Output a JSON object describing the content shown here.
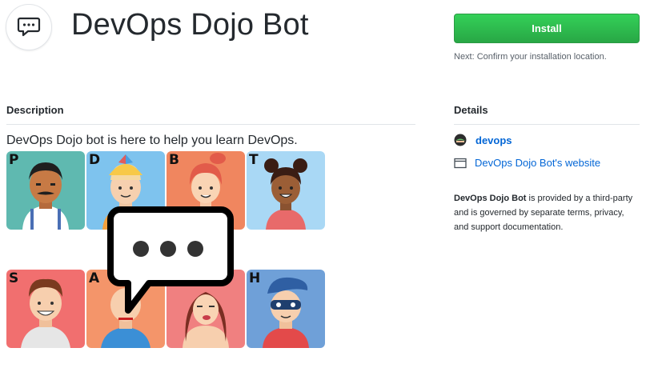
{
  "app": {
    "title": "DevOps Dojo Bot",
    "logo_icon": "chat-bubble-icon"
  },
  "install": {
    "button_label": "Install",
    "hint": "Next: Confirm your installation location."
  },
  "description": {
    "heading": "Description",
    "text": "DevOps Dojo bot is here to help you learn DevOps.",
    "tiles": [
      {
        "letter": "P",
        "bg": "#5fb9b0"
      },
      {
        "letter": "D",
        "bg": "#7ec3ee"
      },
      {
        "letter": "B",
        "bg": "#f0865f"
      },
      {
        "letter": "T",
        "bg": "#a9d8f5"
      },
      {
        "letter": "S",
        "bg": "#f16f6f"
      },
      {
        "letter": "A",
        "bg": "#f4956a"
      },
      {
        "letter": "",
        "bg": "#f08080"
      },
      {
        "letter": "H",
        "bg": "#6fa0d8"
      }
    ]
  },
  "details": {
    "heading": "Details",
    "owner": "devops",
    "website": "DevOps Dojo Bot's website",
    "disclaimer_name": "DevOps Dojo Bot",
    "disclaimer_rest": " is provided by a third-party and is governed by separate terms, privacy, and support documentation."
  }
}
